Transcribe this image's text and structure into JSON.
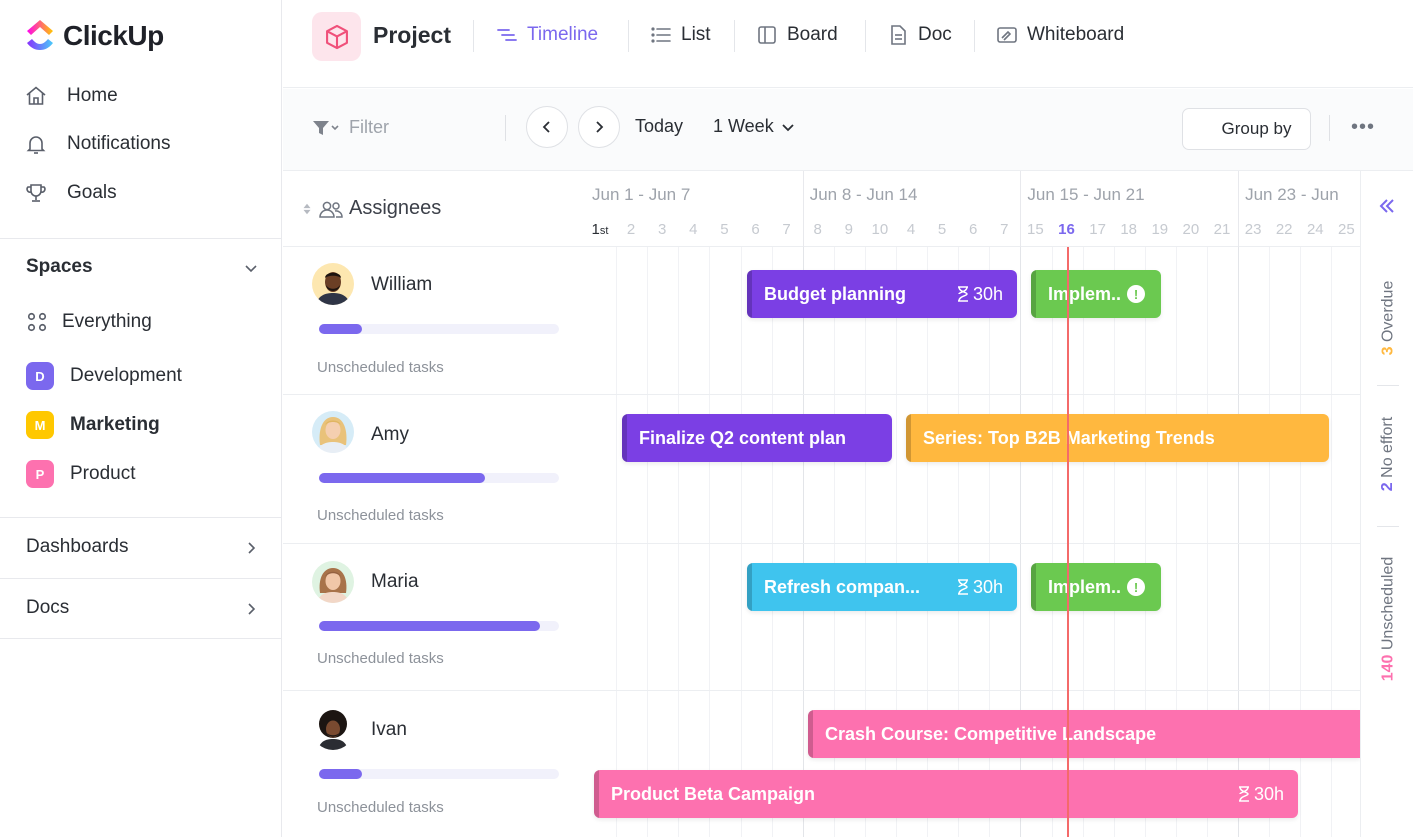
{
  "app": {
    "brand": "ClickUp"
  },
  "sidebar": {
    "nav": [
      {
        "label": "Home",
        "icon": "home-icon"
      },
      {
        "label": "Notifications",
        "icon": "bell-icon"
      },
      {
        "label": "Goals",
        "icon": "trophy-icon"
      }
    ],
    "spaces_title": "Spaces",
    "spaces": [
      {
        "label": "Everything",
        "icon": "grid-dots-icon"
      },
      {
        "label": "Development",
        "badge": "D",
        "color": "#7b68ee"
      },
      {
        "label": "Marketing",
        "badge": "M",
        "color": "#ffc800"
      },
      {
        "label": "Product",
        "badge": "P",
        "color": "#fd71af"
      }
    ],
    "dashboards": "Dashboards",
    "docs": "Docs"
  },
  "header": {
    "project": "Project",
    "views": [
      {
        "label": "Timeline",
        "icon": "timeline-icon",
        "active": true
      },
      {
        "label": "List",
        "icon": "list-icon"
      },
      {
        "label": "Board",
        "icon": "board-icon"
      },
      {
        "label": "Doc",
        "icon": "doc-icon"
      },
      {
        "label": "Whiteboard",
        "icon": "whiteboard-icon"
      }
    ]
  },
  "toolbar": {
    "filter": "Filter",
    "today": "Today",
    "range": "1 Week",
    "group_by": "Group by",
    "more": "•••"
  },
  "timeline": {
    "column_title": "Assignees",
    "weeks": [
      "Jun 1 - Jun 7",
      "Jun 8 - Jun 14",
      "Jun 15 - Jun 21",
      "Jun 23 - Jun"
    ],
    "days": [
      {
        "n": "1",
        "suffix": "st"
      },
      {
        "n": "2"
      },
      {
        "n": "3"
      },
      {
        "n": "4"
      },
      {
        "n": "5"
      },
      {
        "n": "6"
      },
      {
        "n": "7"
      },
      {
        "n": "8"
      },
      {
        "n": "9"
      },
      {
        "n": "10"
      },
      {
        "n": "4"
      },
      {
        "n": "5"
      },
      {
        "n": "6"
      },
      {
        "n": "7"
      },
      {
        "n": "15"
      },
      {
        "n": "16"
      },
      {
        "n": "17"
      },
      {
        "n": "18"
      },
      {
        "n": "19"
      },
      {
        "n": "20"
      },
      {
        "n": "21"
      },
      {
        "n": "23"
      },
      {
        "n": "22"
      },
      {
        "n": "24"
      },
      {
        "n": "25"
      }
    ],
    "today_day": "16",
    "people": [
      {
        "name": "William",
        "progress": 0.18,
        "unscheduled": "Unscheduled tasks"
      },
      {
        "name": "Amy",
        "progress": 0.69,
        "unscheduled": "Unscheduled tasks"
      },
      {
        "name": "Maria",
        "progress": 0.92,
        "unscheduled": "Unscheduled tasks"
      },
      {
        "name": "Ivan",
        "progress": 0.18,
        "unscheduled": "Unscheduled tasks"
      }
    ],
    "tasks": {
      "budget": {
        "label": "Budget planning",
        "estimate": "30h",
        "color": "#7b3fe4"
      },
      "implem1": {
        "label": "Implem..",
        "color": "#6bc950"
      },
      "finalize": {
        "label": "Finalize Q2 content plan",
        "color": "#7b3fe4"
      },
      "series": {
        "label": "Series: Top B2B Marketing Trends",
        "color": "#ffb83f"
      },
      "refresh": {
        "label": "Refresh compan...",
        "estimate": "30h",
        "color": "#3fc4ee"
      },
      "implem2": {
        "label": "Implem..",
        "color": "#6bc950"
      },
      "crash": {
        "label": "Crash Course: Competitive Landscape",
        "color": "#fd71af"
      },
      "beta": {
        "label": "Product Beta Campaign",
        "estimate": "30h",
        "color": "#fd71af"
      }
    }
  },
  "right_panel": {
    "overdue": {
      "count": "3",
      "label": "Overdue",
      "color": "#ffb83f"
    },
    "no_effort": {
      "count": "2",
      "label": "No effort",
      "color": "#7b68ee"
    },
    "unscheduled": {
      "count": "140",
      "label": "Unscheduled",
      "color": "#fd71af"
    }
  }
}
